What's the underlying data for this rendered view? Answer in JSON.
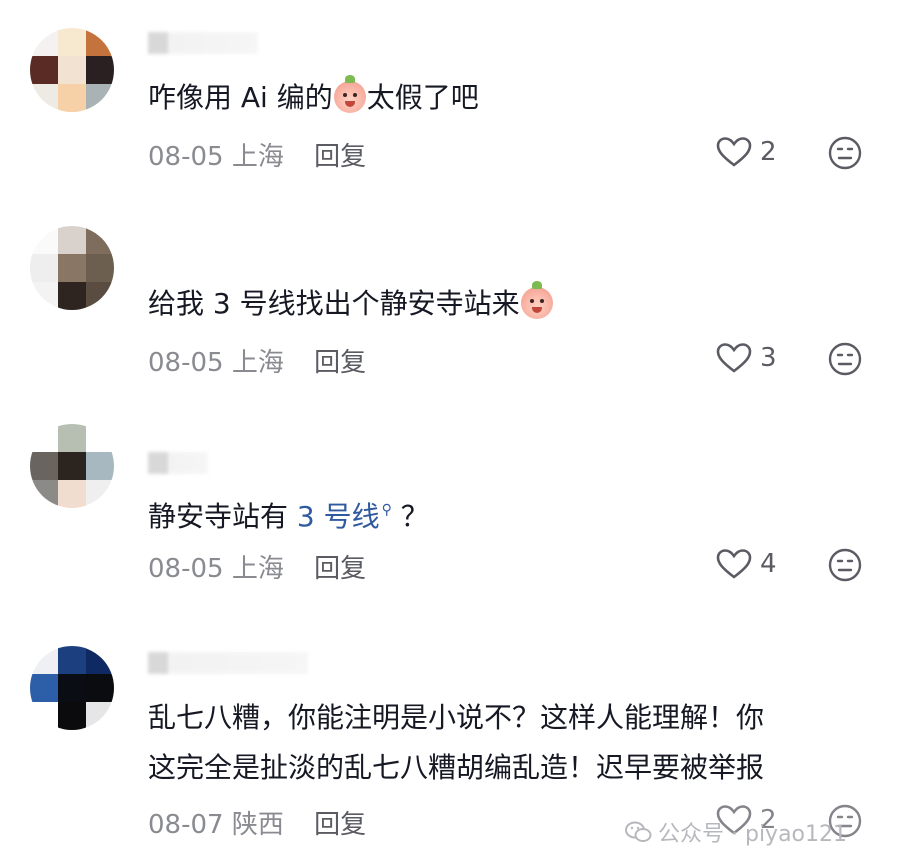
{
  "comments": [
    {
      "text_before_emoji": "咋像用 Ai 编的",
      "text_after_emoji": "太假了吧",
      "date": "08-05",
      "location": "上海",
      "reply_label": "回复",
      "likes": "2",
      "avatar_colors": [
        "#f4f1f0",
        "#f7e9cf",
        "#c4733d",
        "#5a2b24",
        "#f2e2d1",
        "#2a2021",
        "#eeeae4",
        "#f6d0a6",
        "#a9b3b5"
      ]
    },
    {
      "text_before_emoji": "给我 3 号线找出个静安寺站来",
      "text_after_emoji": "",
      "date": "08-05",
      "location": "上海",
      "reply_label": "回复",
      "likes": "3",
      "avatar_colors": [
        "#fafafa",
        "#d9d1cb",
        "#7e6c5c",
        "#eeeeee",
        "#8a7665",
        "#6d5f50",
        "#f3f3f3",
        "#2f2520",
        "#5b4c41"
      ]
    },
    {
      "text_main": "静安寺站有 ",
      "link_text": "3 号线",
      "text_after_link": " ？",
      "date": "08-05",
      "location": "上海",
      "reply_label": "回复",
      "likes": "4",
      "avatar_colors": [
        "#ffffff",
        "#b6bfb2",
        "#ffffff",
        "#6a6460",
        "#2b241f",
        "#a8b8c0",
        "#8c8a86",
        "#f1ddd0",
        "#efefef"
      ]
    },
    {
      "line1": "乱七八糟，你能注明是小说不？这样人能理解！你",
      "line2": "这完全是扯淡的乱七八糟胡编乱造！迟早要被举报",
      "date": "08-07",
      "location": "陕西",
      "reply_label": "回复",
      "likes": "2",
      "avatar_colors": [
        "#eef0f3",
        "#1c3f80",
        "#0f2a63",
        "#2d5fa8",
        "#0b0d14",
        "#0a0c10",
        "#ffffff",
        "#0b0b0d",
        "#e6e6e6"
      ]
    }
  ],
  "watermark": {
    "text": "公众号 · piyao121"
  },
  "icons": {
    "like": "heart-icon",
    "dislike": "meh-face-icon",
    "search": "search-icon",
    "emoji": "peach-emoji-icon",
    "wechat": "wechat-icon"
  }
}
